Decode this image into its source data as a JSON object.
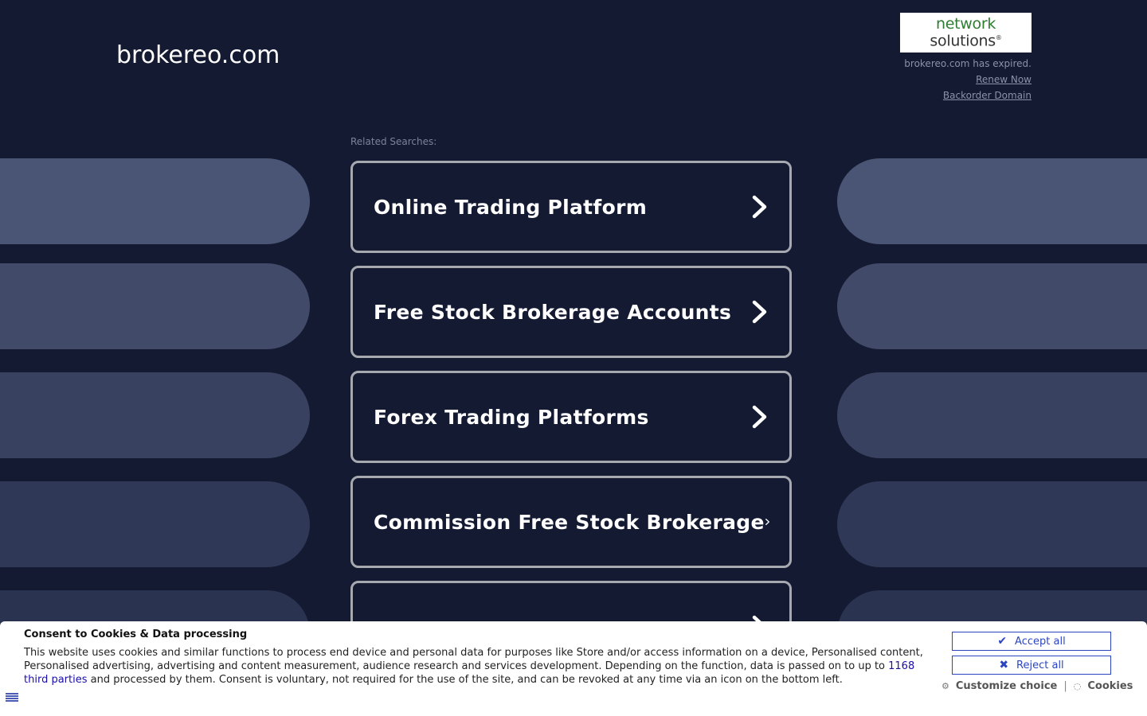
{
  "header": {
    "domain": "brokereo.com",
    "logo": {
      "line1": "network",
      "line2": "solutions",
      "mark": "®"
    },
    "expired_text": "brokereo.com has expired.",
    "renew_link": "Renew Now",
    "backorder_link": "Backorder Domain"
  },
  "related": {
    "label": "Related Searches:",
    "items": [
      {
        "label": "Online Trading Platform"
      },
      {
        "label": "Free Stock Brokerage Accounts"
      },
      {
        "label": "Forex Trading Platforms"
      },
      {
        "label": "Commission Free Stock Brokerage"
      },
      {
        "label": ""
      }
    ]
  },
  "consent": {
    "heading": "Consent to Cookies & Data processing",
    "body_before": "This website uses cookies and similar functions to process end device and personal data for purposes like Store and/or access information on a device, Personalised content, Personalised advertising, advertising and content measurement, audience research and services development. Depending on the function, data is passed on to up to ",
    "third_parties_link": "1168 third parties",
    "body_after": " and processed by them. Consent is voluntary, not required for the use of the site, and can be revoked at any time via an icon on the bottom left.",
    "accept_label": "Accept all",
    "reject_label": "Reject all",
    "customize_label": "Customize choice",
    "separator": "|",
    "cookies_label": "Cookies"
  },
  "icons": {
    "chevron": "chevron-right-icon",
    "accept": "check-icon",
    "reject": "x-icon",
    "customize": "gear-icon",
    "cookies": "cookie-icon",
    "language": "flag-icon"
  },
  "colors": {
    "background": "#131a31",
    "card_border": "#a7a9b1",
    "button_accent": "#2b45c2",
    "logo_green": "#2e7d32"
  }
}
